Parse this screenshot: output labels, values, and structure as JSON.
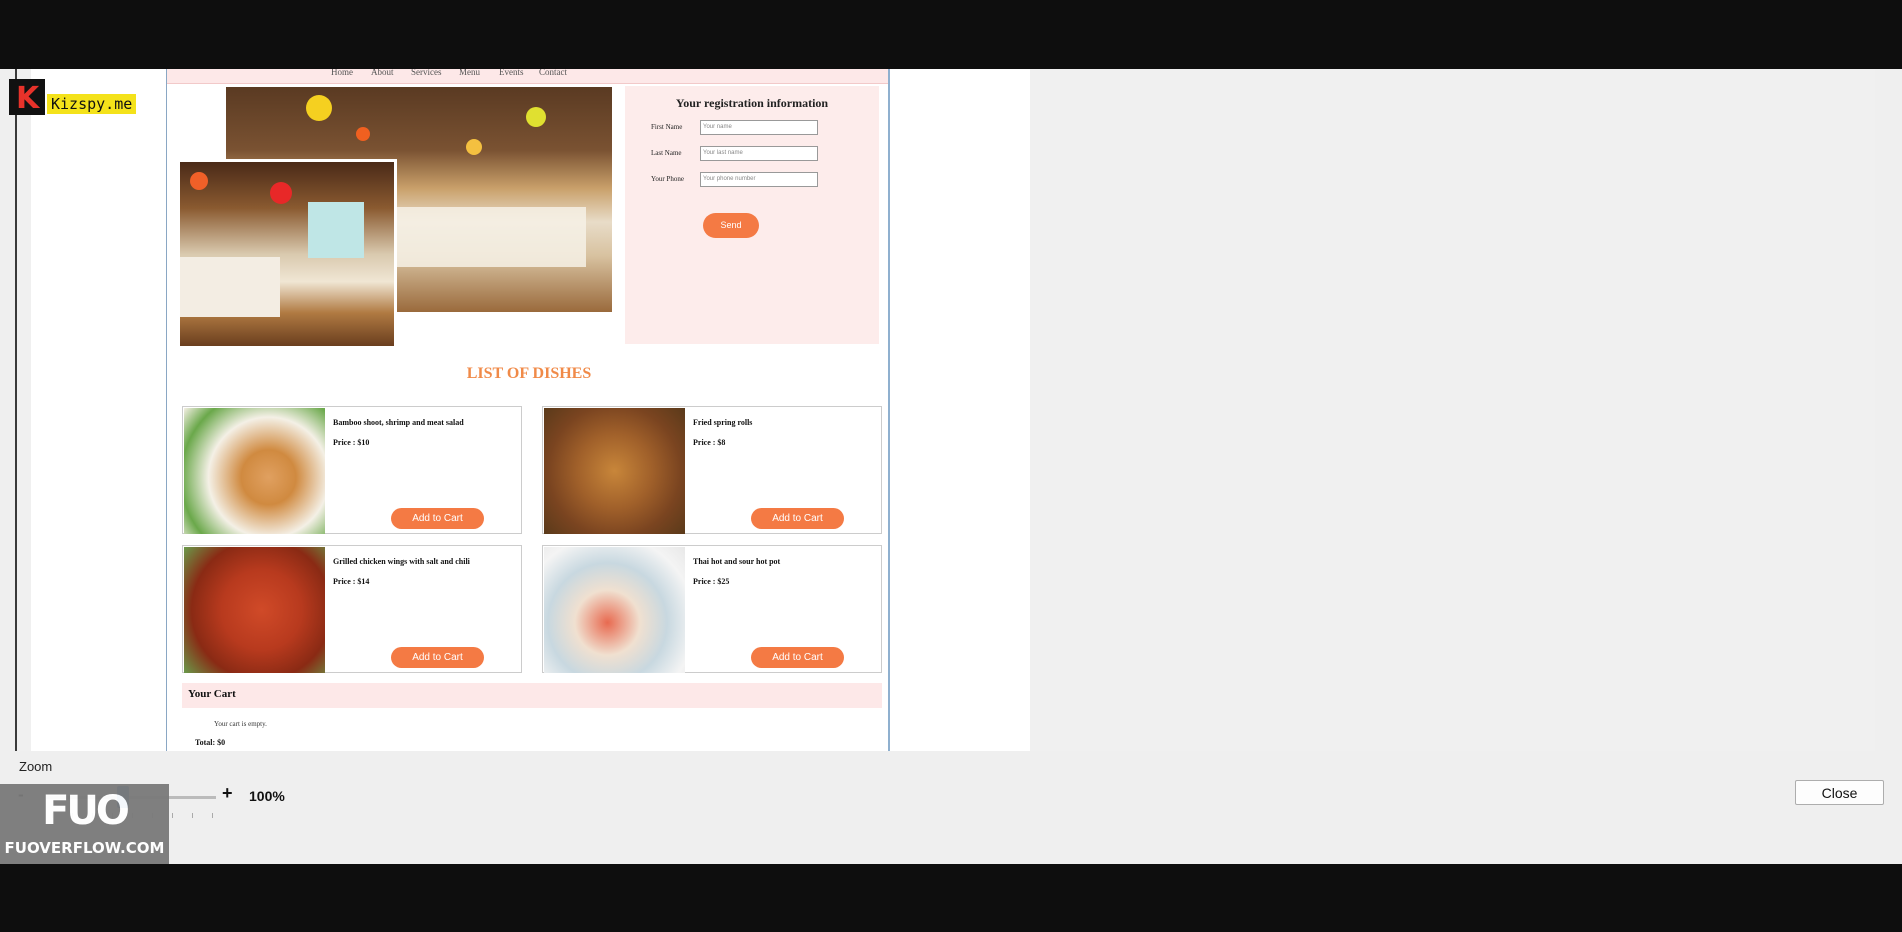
{
  "website": {
    "nav": [
      "Home",
      "About",
      "Services",
      "Menu",
      "Events",
      "Contact"
    ],
    "registration": {
      "title": "Your registration information",
      "fields": [
        {
          "label": "First Name",
          "placeholder": "Your name"
        },
        {
          "label": "Last Name",
          "placeholder": "Your last name"
        },
        {
          "label": "Your Phone",
          "placeholder": "Your phone number"
        }
      ],
      "send_label": "Send"
    },
    "dishes_title": "LIST OF DISHES",
    "dishes": [
      {
        "name": "Bamboo shoot, shrimp and meat salad",
        "price": "Price : $10",
        "button": "Add to Cart"
      },
      {
        "name": "Fried spring rolls",
        "price": "Price : $8",
        "button": "Add to Cart"
      },
      {
        "name": "Grilled chicken wings with salt and chili",
        "price": "Price : $14",
        "button": "Add to Cart"
      },
      {
        "name": "Thai hot and sour hot pot",
        "price": "Price : $25",
        "button": "Add to Cart"
      }
    ],
    "cart": {
      "title": "Your Cart",
      "empty_text": "Your cart is empty.",
      "total": "Total: $0"
    }
  },
  "zoom": {
    "label": "Zoom",
    "minus": "-",
    "plus": "+",
    "value": "100%",
    "level_fraction": 0.45
  },
  "close_label": "Close",
  "watermarks": {
    "kizspy": "Kizspy.me",
    "kizspy_letter": "K",
    "fuo_logo": "FUO",
    "fuo_text": "FUOVERFLOW.COM"
  },
  "colors": {
    "accent_orange": "#f47a44",
    "panel_pink": "#fdeceb",
    "title_orange": "#f08a48",
    "slider_blue": "#1e6bbf"
  }
}
